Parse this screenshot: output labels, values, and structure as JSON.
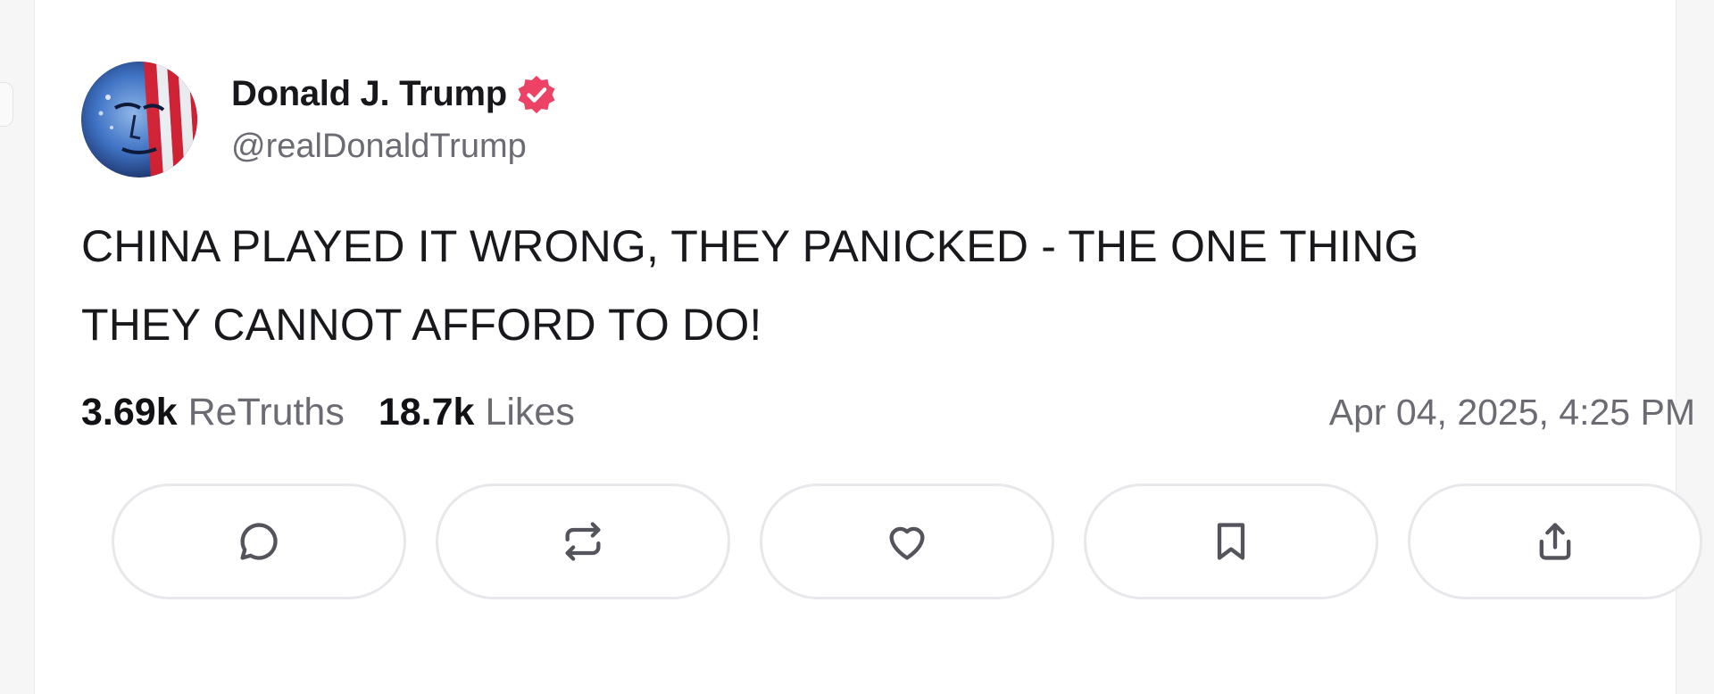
{
  "post": {
    "author": {
      "display_name": "Donald J. Trump",
      "handle": "@realDonaldTrump",
      "verified": true,
      "verified_color": "#ec4266"
    },
    "text_lines": [
      "CHINA PLAYED IT WRONG, THEY PANICKED - THE ONE THING",
      "THEY CANNOT AFFORD TO DO!"
    ],
    "stats": {
      "retruths_count": "3.69k",
      "retruths_label": "ReTruths",
      "likes_count": "18.7k",
      "likes_label": "Likes"
    },
    "timestamp": "Apr 04, 2025, 4:25 PM"
  },
  "actions": [
    {
      "name": "reply",
      "icon": "comment-icon"
    },
    {
      "name": "retruth",
      "icon": "repost-icon"
    },
    {
      "name": "like",
      "icon": "heart-icon"
    },
    {
      "name": "bookmark",
      "icon": "bookmark-icon"
    },
    {
      "name": "share",
      "icon": "share-icon"
    }
  ],
  "colors": {
    "text_primary": "#17171c",
    "text_secondary": "#6b6b73",
    "border": "#e8e8ec",
    "icon": "#54545c"
  }
}
